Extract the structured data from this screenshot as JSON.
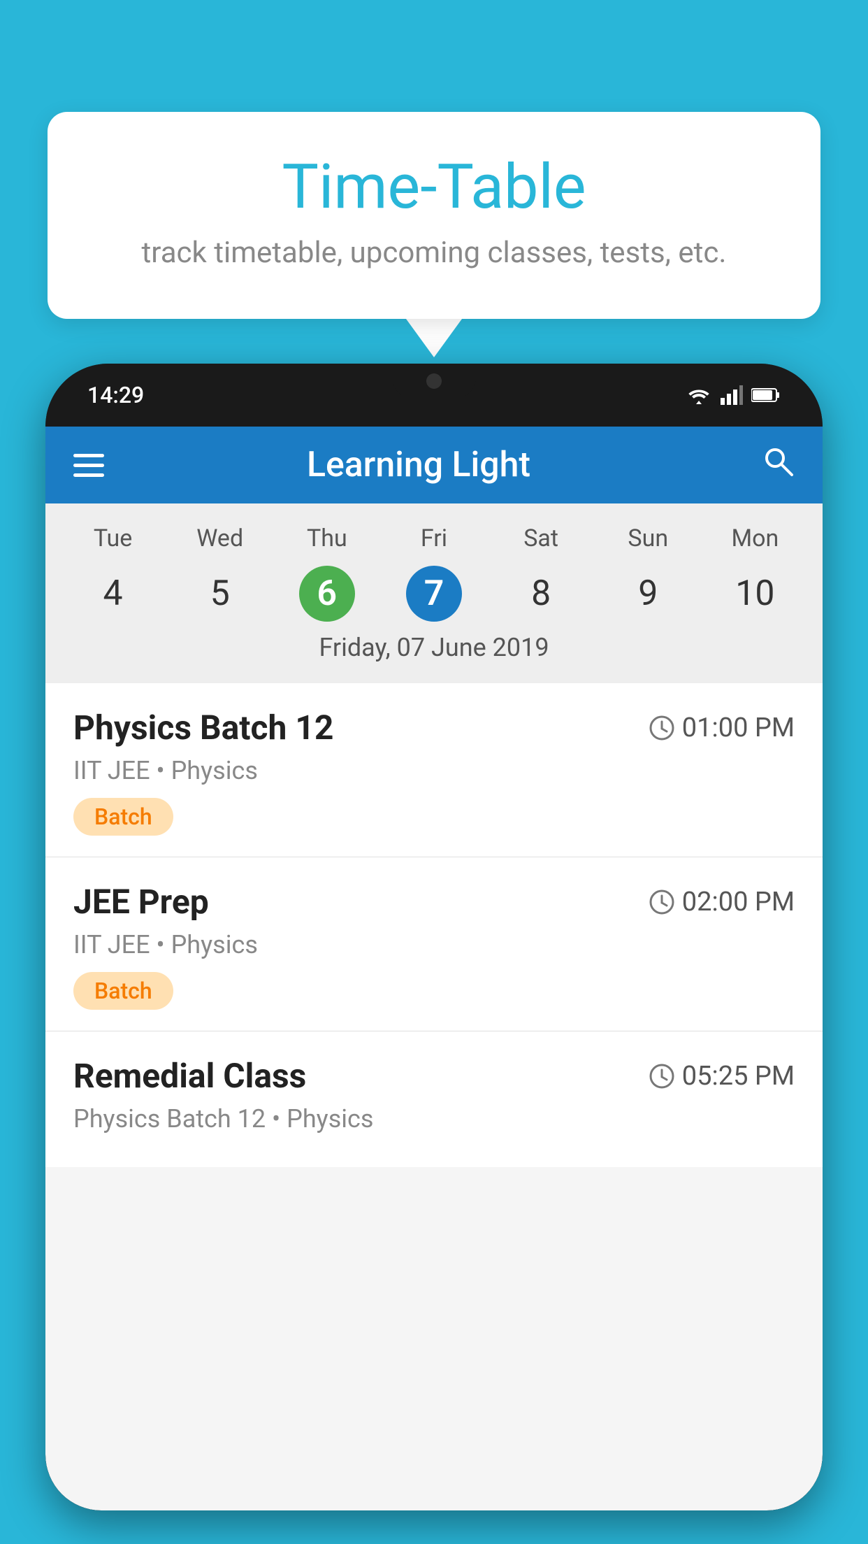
{
  "page": {
    "background_color": "#29B6D8"
  },
  "speech_bubble": {
    "title": "Time-Table",
    "subtitle": "track timetable, upcoming classes, tests, etc."
  },
  "phone": {
    "status_bar": {
      "time": "14:29"
    },
    "app_header": {
      "title": "Learning Light"
    },
    "calendar": {
      "days": [
        "Tue",
        "Wed",
        "Thu",
        "Fri",
        "Sat",
        "Sun",
        "Mon"
      ],
      "dates": [
        "4",
        "5",
        "6",
        "7",
        "8",
        "9",
        "10"
      ],
      "today_index": 2,
      "selected_index": 3,
      "selected_date_label": "Friday, 07 June 2019"
    },
    "schedule": [
      {
        "title": "Physics Batch 12",
        "time": "01:00 PM",
        "subtitle": "IIT JEE • Physics",
        "tag": "Batch"
      },
      {
        "title": "JEE Prep",
        "time": "02:00 PM",
        "subtitle": "IIT JEE • Physics",
        "tag": "Batch"
      },
      {
        "title": "Remedial Class",
        "time": "05:25 PM",
        "subtitle": "Physics Batch 12 • Physics",
        "tag": ""
      }
    ]
  }
}
